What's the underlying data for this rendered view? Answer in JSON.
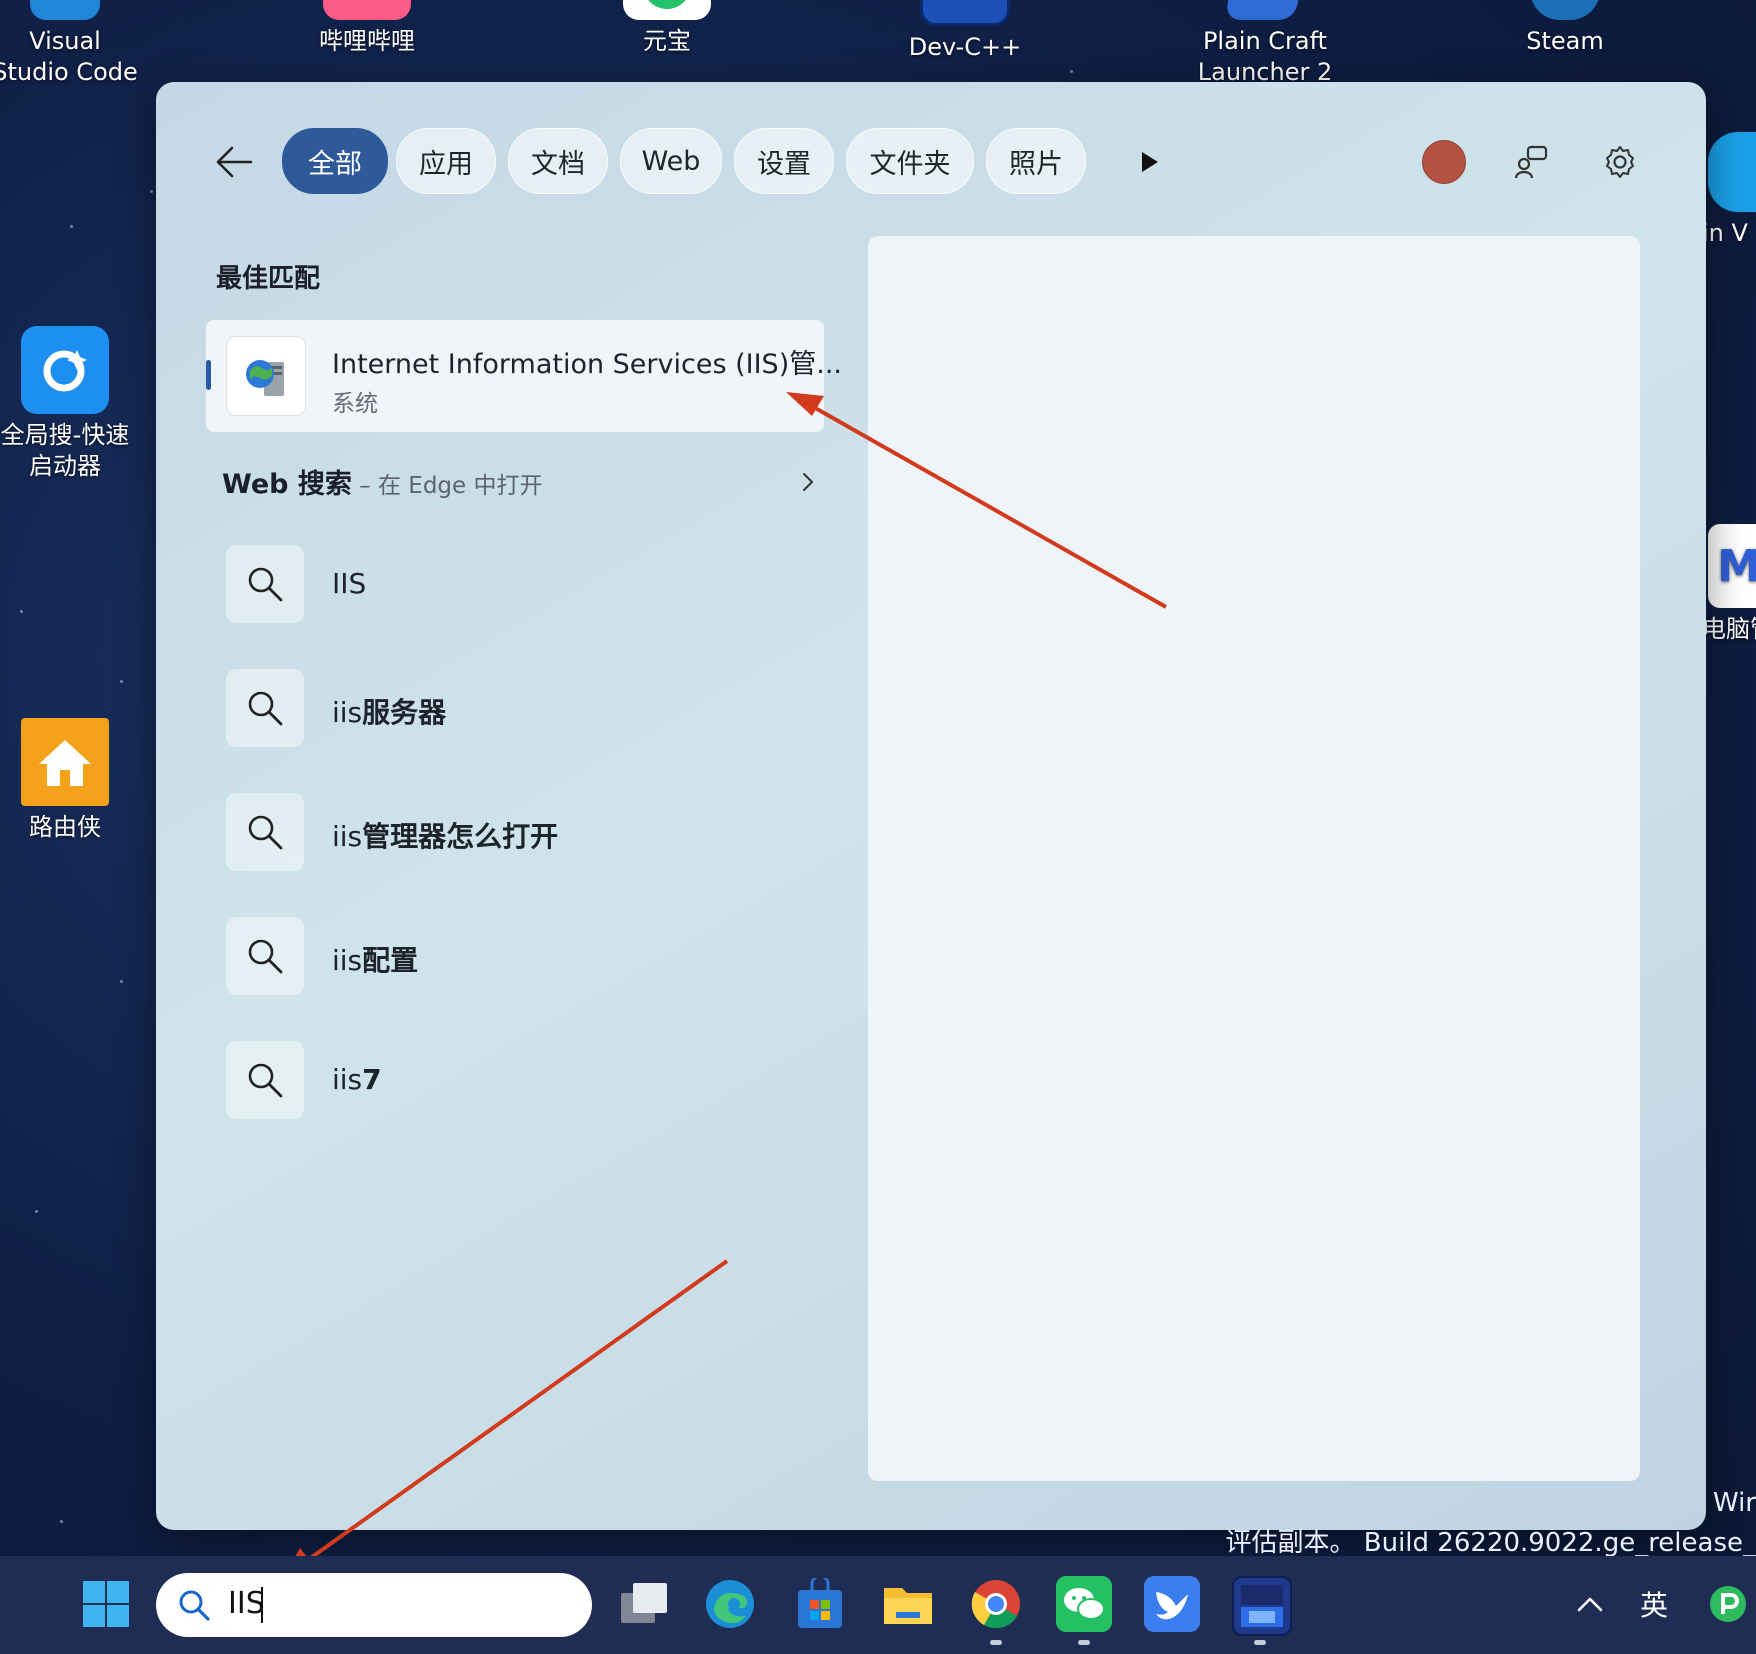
{
  "desktop_icons": [
    {
      "label": "Visual\nStudio Code",
      "icon": "vscode-icon"
    },
    {
      "label": "哔哩哔哩",
      "icon": "bilibili-icon"
    },
    {
      "label": "元宝",
      "icon": "yuanbao-icon"
    },
    {
      "label": "Dev-C++",
      "icon": "devcpp-icon"
    },
    {
      "label": "Plain Craft\nLauncher 2",
      "icon": "pcl-icon"
    },
    {
      "label": "Steam",
      "icon": "steam-icon"
    },
    {
      "label": "全局搜-快速\n启动器",
      "icon": "quicksearch-icon"
    },
    {
      "label": "路由侠",
      "icon": "router-icon"
    },
    {
      "label": "in V",
      "icon": "partial-app-icon"
    },
    {
      "label": "电脑管",
      "icon": "pc-manager-icon"
    }
  ],
  "filters": [
    "全部",
    "应用",
    "文档",
    "Web",
    "设置",
    "文件夹",
    "照片"
  ],
  "best_match": {
    "heading": "最佳匹配",
    "title": "Internet Information Services (IIS)管...",
    "subtitle": "系统"
  },
  "web_search": {
    "label": "Web 搜索",
    "sub": " – 在 Edge 中打开"
  },
  "suggestions": [
    {
      "prefix": "IIS",
      "bold": ""
    },
    {
      "prefix": "iis",
      "bold": "服务器"
    },
    {
      "prefix": "iis",
      "bold": "管理器怎么打开"
    },
    {
      "prefix": "iis",
      "bold": "配置"
    },
    {
      "prefix": "iis",
      "bold": "7"
    }
  ],
  "taskbar": {
    "search_value": "IIS",
    "tray": {
      "ime": "英"
    }
  },
  "watermark": {
    "line1": "Wir",
    "line2": "评估副本。 Build 26220.9022.ge_release_"
  },
  "colors": {
    "accent": "#2e5a99",
    "annotation_arrow": "#d23a1e",
    "avatar": "#b35142"
  }
}
